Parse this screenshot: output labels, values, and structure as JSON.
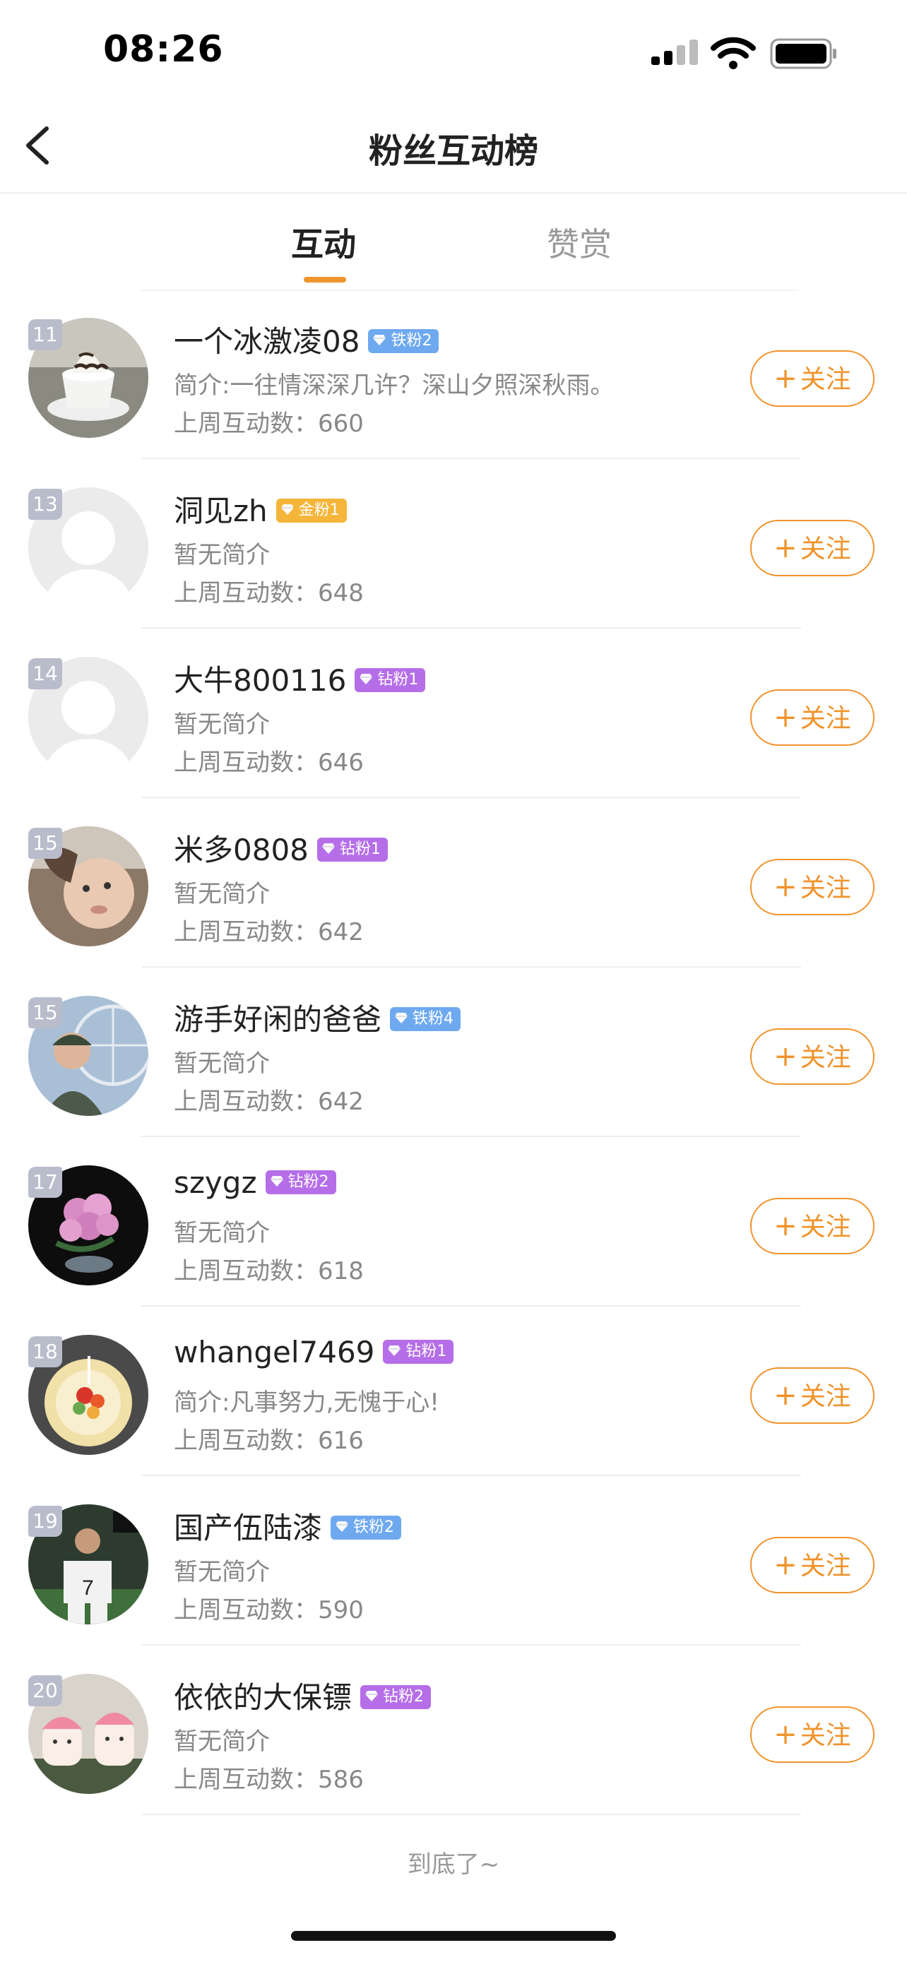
{
  "status_bar": {
    "time": "08:26"
  },
  "nav": {
    "title": "粉丝互动榜"
  },
  "tabs": [
    {
      "label": "互动",
      "active": true
    },
    {
      "label": "赞赏",
      "active": false
    }
  ],
  "colors": {
    "accent": "#f0932b",
    "iron_badge": "#6ea9f0",
    "gold_badge": "#f5b53a",
    "diamond_badge": "#b56ee8"
  },
  "follow_label": "关注",
  "count_prefix": "上周互动数：",
  "fans": [
    {
      "rank": "11",
      "name": "一个冰激凌08",
      "badge": "铁粉2",
      "badge_type": "iron",
      "bio": "简介:一往情深深几许？深山夕照深秋雨。",
      "count": "660",
      "avatar": "ice-cream-cup"
    },
    {
      "rank": "13",
      "name": "洞见zh",
      "badge": "金粉1",
      "badge_type": "gold",
      "bio": "暂无简介",
      "count": "648",
      "avatar": "default"
    },
    {
      "rank": "14",
      "name": "大牛800116",
      "badge": "钻粉1",
      "badge_type": "diamond",
      "bio": "暂无简介",
      "count": "646",
      "avatar": "default"
    },
    {
      "rank": "15",
      "name": "米多0808",
      "badge": "钻粉1",
      "badge_type": "diamond",
      "bio": "暂无简介",
      "count": "642",
      "avatar": "baby"
    },
    {
      "rank": "15",
      "name": "游手好闲的爸爸",
      "badge": "铁粉4",
      "badge_type": "iron",
      "bio": "暂无简介",
      "count": "642",
      "avatar": "man-ferris-wheel"
    },
    {
      "rank": "17",
      "name": "szygz",
      "badge": "钻粉2",
      "badge_type": "diamond",
      "bio": "暂无简介",
      "count": "618",
      "avatar": "pink-roses"
    },
    {
      "rank": "18",
      "name": "whangel7469",
      "badge": "钻粉1",
      "badge_type": "diamond",
      "bio": "简介:凡事努力,无愧于心!",
      "count": "616",
      "avatar": "fruit-cake"
    },
    {
      "rank": "19",
      "name": "国产伍陆漆",
      "badge": "铁粉2",
      "badge_type": "iron",
      "bio": "暂无简介",
      "count": "590",
      "avatar": "football-player"
    },
    {
      "rank": "20",
      "name": "依依的大保镖",
      "badge": "钻粉2",
      "badge_type": "diamond",
      "bio": "暂无简介",
      "count": "586",
      "avatar": "cartoon-cakes"
    }
  ],
  "footer": {
    "end_text": "到底了~"
  }
}
